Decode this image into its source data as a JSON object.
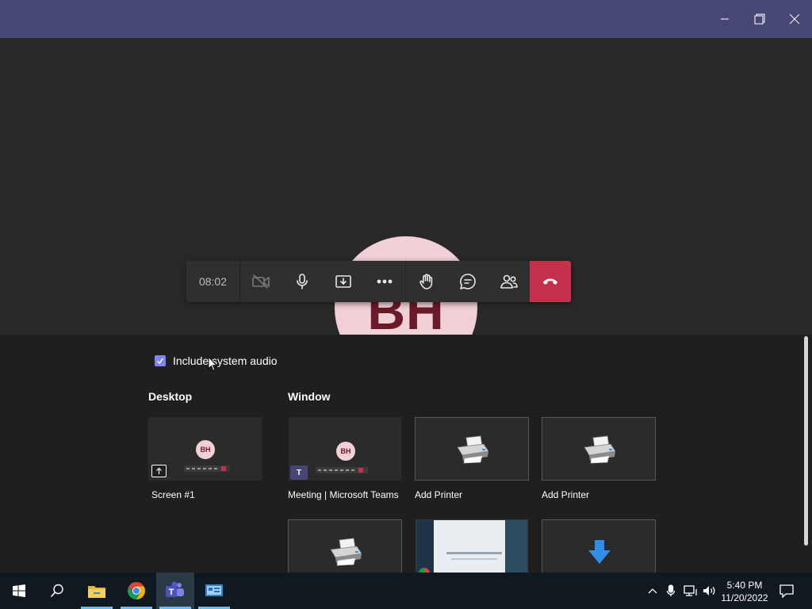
{
  "window": {
    "controls": [
      "minimize-icon",
      "restore-icon",
      "close-icon"
    ]
  },
  "stage": {
    "participant_initials": "BH"
  },
  "callbar": {
    "timer": "08:02",
    "buttons": [
      "camera-off-icon",
      "microphone-icon",
      "share-tray-icon",
      "more-icon",
      "raise-hand-icon",
      "chat-icon",
      "participants-icon",
      "hang-up-icon"
    ],
    "hangup_color": "#c4314b"
  },
  "share_tray": {
    "include_audio_label": "Include system audio",
    "include_audio_checked": true,
    "desktop_heading": "Desktop",
    "window_heading": "Window",
    "desktop_items": [
      {
        "label": "Screen #1",
        "preview_initials": "BH"
      }
    ],
    "window_items": [
      {
        "label": "Meeting | Microsoft Teams",
        "preview_initials": "BH"
      },
      {
        "label": "Add Printer"
      },
      {
        "label": "Add Printer"
      },
      {
        "label": ""
      },
      {
        "label": ""
      },
      {
        "label": ""
      }
    ]
  },
  "taskbar": {
    "apps": [
      "windows-start-icon",
      "search-icon",
      "file-explorer-icon",
      "chrome-icon",
      "teams-icon",
      "control-panel-icon"
    ],
    "clock_time": "5:40 PM",
    "clock_date": "11/20/2022"
  },
  "colors": {
    "titlebar": "#464775",
    "accent": "#7f85f5",
    "avatar_bg": "#f1d1d5",
    "avatar_text": "#6b1a27"
  }
}
